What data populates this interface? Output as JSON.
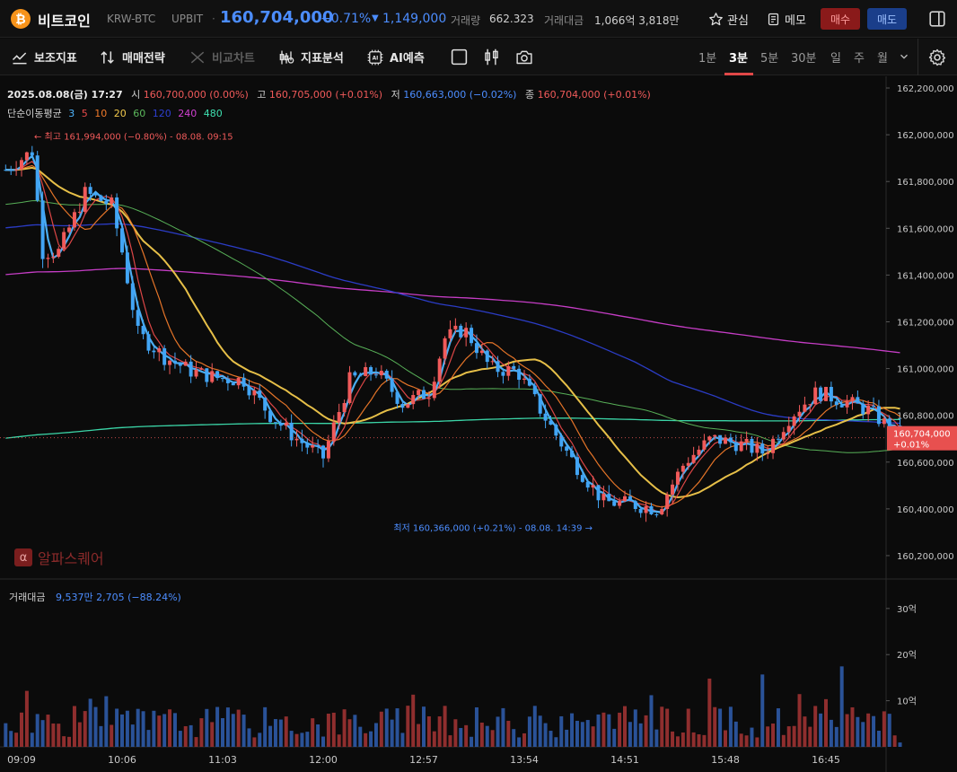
{
  "header": {
    "logo_glyph": "₿",
    "coin_name": "비트코인",
    "pair": "KRW-BTC",
    "exchange": "UPBIT",
    "separator": "·",
    "price": "160,704,000",
    "change_pct": "−0.71%",
    "change_arrow": "▼",
    "change_abs": "1,149,000",
    "volume_label": "거래량",
    "volume_value": "662.323",
    "amount_label": "거래대금",
    "amount_value": "1,066억 3,818만",
    "watch_label": "관심",
    "memo_label": "메모",
    "buy_label": "매수",
    "sell_label": "매도"
  },
  "toolbar": {
    "indicators_label": "보조지표",
    "strategy_label": "매매전략",
    "compare_label": "비교차트",
    "analysis_label": "지표분석",
    "ai_label": "AI예측",
    "ai_icon_text": "AI",
    "timeframes": [
      "1분",
      "3분",
      "5분",
      "30분",
      "일",
      "주",
      "월"
    ],
    "active_timeframe": "3분"
  },
  "legend": {
    "datetime": "2025.08.08(금) 17:27",
    "open_label": "시",
    "open_value": "160,700,000 (0.00%)",
    "high_label": "고",
    "high_value": "160,705,000 (+0.01%)",
    "low_label": "저",
    "low_value": "160,663,000 (−0.02%)",
    "close_label": "종",
    "close_value": "160,704,000 (+0.01%)",
    "ma_label": "단순이동평균",
    "ma_periods": [
      {
        "period": "3",
        "color": "#4fb6ff"
      },
      {
        "period": "5",
        "color": "#e84a4a"
      },
      {
        "period": "10",
        "color": "#f07a2a"
      },
      {
        "period": "20",
        "color": "#f2c94c"
      },
      {
        "period": "60",
        "color": "#5cb85c"
      },
      {
        "period": "120",
        "color": "#2d3fd0"
      },
      {
        "period": "240",
        "color": "#d040d0"
      },
      {
        "period": "480",
        "color": "#3ee0b0"
      }
    ]
  },
  "annotations": {
    "high": "← 최고 161,994,000 (−0.80%) - 08.08. 09:15",
    "low": "최저 160,366,000 (+0.21%) - 08.08. 14:39 →",
    "last_price": "160,704,000",
    "last_pct": "+0.01%"
  },
  "watermark": {
    "badge": "α",
    "text": "알파스퀘어"
  },
  "volume_legend": {
    "label": "거래대금",
    "value": "9,537만 2,705 (−88.24%)"
  },
  "colors": {
    "up": "#f05a5a",
    "down": "#4c8dff",
    "up_candle": "#f05a5a",
    "down_candle": "#42a5f5",
    "up_volume": "#8f2e2e",
    "down_volume": "#2a5298"
  },
  "chart_data": {
    "type": "candlestick",
    "price_axis": {
      "min": 160100000,
      "max": 162250000,
      "ticks": [
        "162,200,000",
        "162,000,000",
        "161,800,000",
        "161,600,000",
        "161,400,000",
        "161,200,000",
        "161,000,000",
        "160,800,000",
        "160,600,000",
        "160,400,000",
        "160,200,000"
      ],
      "tick_values": [
        162200000,
        162000000,
        161800000,
        161600000,
        161400000,
        161200000,
        161000000,
        160800000,
        160600000,
        160400000,
        160200000
      ]
    },
    "volume_axis": {
      "ticks": [
        "30억",
        "20억",
        "10억"
      ],
      "tick_values": [
        3000000000,
        2000000000,
        1000000000
      ],
      "max": 3600000000
    },
    "time_ticks": [
      "09:09",
      "10:06",
      "11:03",
      "12:00",
      "12:57",
      "13:54",
      "14:51",
      "15:48",
      "16:45"
    ],
    "close_anchors": [
      {
        "t": "09:00",
        "v": 161850000
      },
      {
        "t": "09:15",
        "v": 161930000
      },
      {
        "t": "09:21",
        "v": 161500000
      },
      {
        "t": "09:30",
        "v": 161500000
      },
      {
        "t": "09:45",
        "v": 161750000
      },
      {
        "t": "10:00",
        "v": 161700000
      },
      {
        "t": "10:06",
        "v": 161500000
      },
      {
        "t": "10:15",
        "v": 161150000
      },
      {
        "t": "10:30",
        "v": 161050000
      },
      {
        "t": "10:45",
        "v": 160990000
      },
      {
        "t": "11:00",
        "v": 160960000
      },
      {
        "t": "11:15",
        "v": 160950000
      },
      {
        "t": "11:30",
        "v": 160800000
      },
      {
        "t": "11:45",
        "v": 160700000
      },
      {
        "t": "12:00",
        "v": 160620000
      },
      {
        "t": "12:15",
        "v": 160950000
      },
      {
        "t": "12:30",
        "v": 160990000
      },
      {
        "t": "12:45",
        "v": 160850000
      },
      {
        "t": "13:00",
        "v": 160900000
      },
      {
        "t": "13:09",
        "v": 161130000
      },
      {
        "t": "13:20",
        "v": 161170000
      },
      {
        "t": "13:35",
        "v": 161000000
      },
      {
        "t": "13:50",
        "v": 160990000
      },
      {
        "t": "14:05",
        "v": 160800000
      },
      {
        "t": "14:20",
        "v": 160620000
      },
      {
        "t": "14:39",
        "v": 160430000
      },
      {
        "t": "14:55",
        "v": 160420000
      },
      {
        "t": "15:10",
        "v": 160400000
      },
      {
        "t": "15:25",
        "v": 160600000
      },
      {
        "t": "15:40",
        "v": 160700000
      },
      {
        "t": "15:55",
        "v": 160680000
      },
      {
        "t": "16:10",
        "v": 160640000
      },
      {
        "t": "16:25",
        "v": 160800000
      },
      {
        "t": "16:40",
        "v": 160900000
      },
      {
        "t": "16:55",
        "v": 160860000
      },
      {
        "t": "17:10",
        "v": 160820000
      },
      {
        "t": "17:27",
        "v": 160704000
      }
    ],
    "high": 161994000,
    "low": 160366000,
    "last": 160704000
  }
}
